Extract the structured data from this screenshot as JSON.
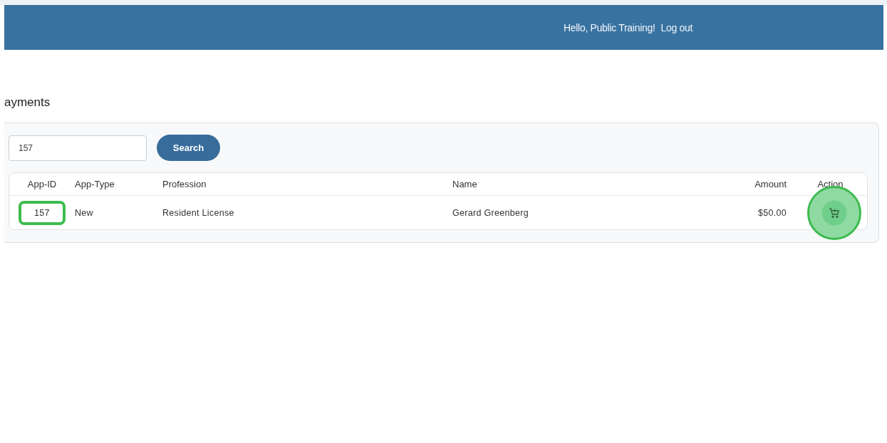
{
  "header": {
    "greeting": "Hello, Public Training!",
    "logout": "Log out"
  },
  "page_title": "ayments",
  "search": {
    "value": "157",
    "button": "Search"
  },
  "table": {
    "columns": [
      "App-ID",
      "App-Type",
      "Profession",
      "Name",
      "Amount",
      "Action"
    ],
    "rows": [
      {
        "app_id": "157",
        "app_id_highlighted": true,
        "app_type": "New",
        "profession": "Resident License",
        "name": "Gerard Greenberg",
        "amount": "$50.00",
        "action_highlighted": true
      }
    ]
  }
}
